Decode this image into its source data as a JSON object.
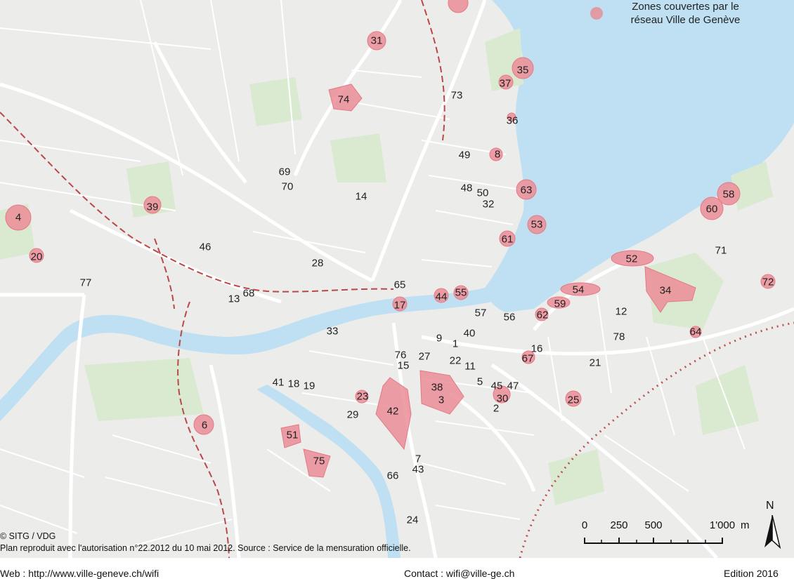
{
  "legend": {
    "line1": "Zones couvertes par le",
    "line2": "réseau Ville de Genève",
    "color": "#e58f98"
  },
  "colors": {
    "water": "#bfe0f2",
    "park": "#d9ead0",
    "zone": "#eb8d96",
    "railway": "#b94848"
  },
  "zones": [
    "1",
    "2",
    "3",
    "4",
    "5",
    "6",
    "7",
    "8",
    "9",
    "11",
    "12",
    "13",
    "14",
    "15",
    "16",
    "17",
    "18",
    "19",
    "20",
    "21",
    "22",
    "23",
    "24",
    "25",
    "27",
    "28",
    "29",
    "30",
    "31",
    "32",
    "33",
    "34",
    "35",
    "36",
    "37",
    "38",
    "39",
    "40",
    "41",
    "42",
    "43",
    "44",
    "45",
    "46",
    "47",
    "48",
    "49",
    "50",
    "51",
    "52",
    "53",
    "54",
    "55",
    "56",
    "57",
    "58",
    "59",
    "60",
    "61",
    "62",
    "63",
    "64",
    "65",
    "66",
    "67",
    "68",
    "69",
    "70",
    "71",
    "72",
    "73",
    "74",
    "75",
    "76",
    "77",
    "78"
  ],
  "copyright": "© SITG / VDG",
  "credits": "Plan reproduit avec l'autorisation n°22.2012 du 10 mai 2012. Source : Service de la mensuration officielle.",
  "scale": {
    "ticks": [
      "0",
      "250",
      "500",
      "1'000"
    ],
    "unit": "m"
  },
  "north": "N",
  "footer": {
    "web": "Web : http://www.ville-geneve.ch/wifi",
    "contact": "Contact : wifi@ville-ge.ch",
    "edition": "Edition 2016"
  }
}
